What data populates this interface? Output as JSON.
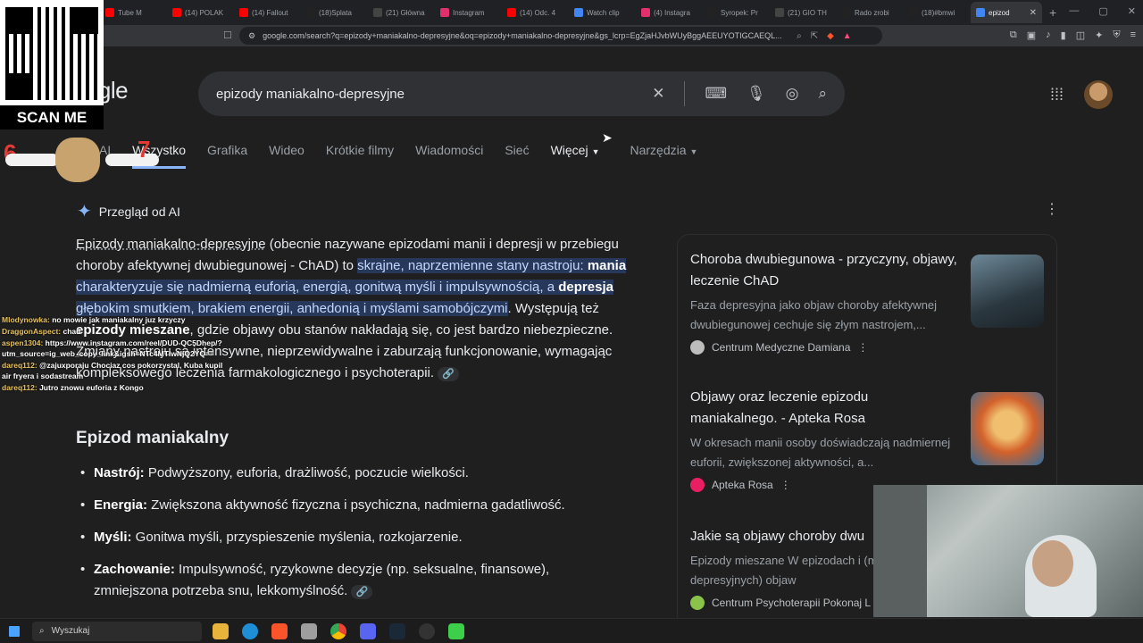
{
  "browser": {
    "tabs": [
      {
        "label": "Tube M",
        "color": "#ff0000"
      },
      {
        "label": "(14) POLAK",
        "color": "#ff0000"
      },
      {
        "label": "(14) Fallout",
        "color": "#ff0000"
      },
      {
        "label": "(18)Splata",
        "color": "#222222"
      },
      {
        "label": "(21) Główna",
        "color": "#444444"
      },
      {
        "label": "Instagram",
        "color": "#e1306c"
      },
      {
        "label": "(14) Odc. 4",
        "color": "#ff0000"
      },
      {
        "label": "Watch clip",
        "color": "#4285f4"
      },
      {
        "label": "(4) Instagra",
        "color": "#e1306c"
      },
      {
        "label": "Syropek: Pr",
        "color": "#222222"
      },
      {
        "label": "(21) GIO TH",
        "color": "#444444"
      },
      {
        "label": "Rado zrobi",
        "color": "#222222"
      },
      {
        "label": "(18)#bmwi",
        "color": "#222222"
      },
      {
        "label": "epizod",
        "color": "#4285f4"
      }
    ],
    "url": "google.com/search?q=epizody+maniakalno-depresyjne&oq=epizody+maniakalno-depresyjne&gs_lcrp=EgZjaHJvbWUyBggAEEUYOTIGCAEQL..."
  },
  "google": {
    "logo": "oogle",
    "query": "epizody maniakalno-depresyjne",
    "nav": [
      "b AI",
      "Wszystko",
      "Grafika",
      "Wideo",
      "Krótkie filmy",
      "Wiadomości",
      "Sieć",
      "Więcej",
      "Narzędzia"
    ],
    "ai_header": "Przegląd od AI",
    "ai_para": {
      "p1": "Epizody maniakalno-depresyjne",
      "p2": " (obecnie nazywane epizodami manii i depresji w przebiegu choroby afektywnej dwubiegunowej - ChAD) to ",
      "p3": "skrajne, naprzemienne stany nastroju: ",
      "p4": "mania",
      "p5": " charakteryzuje się nadmierną euforią, energią, gonitwą myśli i impulsywnością, a ",
      "p6": "depresja",
      "p7": " głębokim smutkiem, brakiem energii, anhedonią i myślami samobójczymi",
      "p8": ". Występują też ",
      "p9": "epizody mieszane",
      "p10": ", gdzie objawy obu stanów nakładają się, co jest bardzo niebezpieczne. Zmiany nastroju są intensywne, nieprzewidywalne i zaburzają funkcjonowanie, wymagając kompleksowego leczenia farmakologicznego i psychoterapii."
    },
    "section_title": "Epizod maniakalny",
    "bullets": [
      {
        "k": "Nastrój:",
        "v": " Podwyższony, euforia, drażliwość, poczucie wielkości."
      },
      {
        "k": "Energia:",
        "v": " Zwiększona aktywność fizyczna i psychiczna, nadmierna gadatliwość."
      },
      {
        "k": "Myśli:",
        "v": " Gonitwa myśli, przyspieszenie myślenia, rozkojarzenie."
      },
      {
        "k": "Zachowanie:",
        "v": " Impulsywność, ryzykowne decyzje (np. seksualne, finansowe), zmniejszona potrzeba snu, lekkomyślność."
      }
    ],
    "sources": [
      {
        "title": "Choroba dwubiegunowa - przyczyny, objawy, leczenie ChAD",
        "snippet": "Faza depresyjna jako objaw choroby afektywnej dwubiegunowej cechuje się złym nastrojem,...",
        "site": "Centrum Medyczne Damiana",
        "fav": "#bdbdbd",
        "thumb": "#3a4a55"
      },
      {
        "title": "Objawy oraz leczenie epizodu maniakalnego. - Apteka Rosa",
        "snippet": "W okresach manii osoby doświadczają nadmiernej euforii, zwiększonej aktywności, a...",
        "site": "Apteka Rosa",
        "fav": "#e91e63",
        "thumb": "#c8833a"
      },
      {
        "title": "Jakie są objawy choroby dwu",
        "snippet": "Epizody mieszane W epizodach i (maniakalno-depresyjnych) objaw",
        "site": "Centrum Psychoterapii Pokonaj L",
        "fav": "#8bc34a",
        "thumb": "#555"
      }
    ]
  },
  "overlay": {
    "qr_label": "SCAN ME",
    "chat": [
      {
        "user": "Mlodynowka:",
        "msg": " no mowie jak maniakalny juz krzyczy"
      },
      {
        "user": "DraggonAspect:",
        "msg": " chad"
      },
      {
        "user": "aspen1304:",
        "msg": " https://www.instagram.com/reel/DUD-QC5Dhep/?utm_source=ig_web_copy_link&igsh=NTc4MTIwNjQ2YQ=="
      },
      {
        "user": "dareq112:",
        "msg": " @zajuxporaju Chociaz cos pokorzystal, Kuba kupil air fryera i sodastream"
      },
      {
        "user": "dareq112:",
        "msg": " Jutro znowu euforia z Kongo"
      }
    ]
  },
  "taskbar": {
    "search": "Wyszukaj"
  }
}
